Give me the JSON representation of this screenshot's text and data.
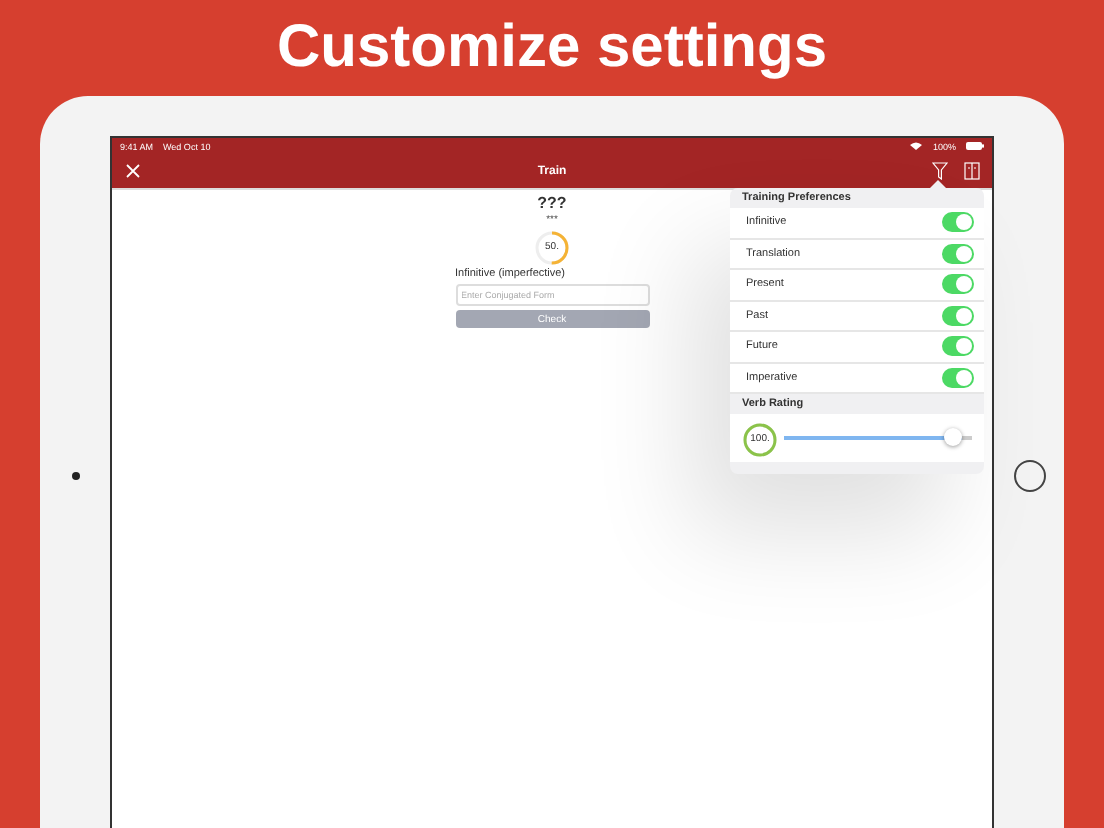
{
  "headline": "Customize settings",
  "status_bar": {
    "time": "9:41 AM",
    "date": "Wed Oct 10",
    "battery": "100%"
  },
  "nav": {
    "title": "Train"
  },
  "card": {
    "word": "???",
    "hint": "***",
    "progress": {
      "reading": "50."
    },
    "label": "Infinitive (imperfective)",
    "input": {
      "placeholder": "Enter Conjugated Form"
    },
    "button": {
      "label": "Check",
      "disabled": true
    }
  },
  "popover": {
    "sections": [
      {
        "title": "Training Preferences",
        "kind": "toggles",
        "items": [
          {
            "label": "Infinitive",
            "on": true
          },
          {
            "label": "Translation",
            "on": true
          },
          {
            "label": "Present",
            "on": true
          },
          {
            "label": "Past",
            "on": true
          },
          {
            "label": "Future",
            "on": true
          },
          {
            "label": "Imperative",
            "on": true
          }
        ]
      },
      {
        "title": "Verb Rating",
        "kind": "slider",
        "reading": "100.",
        "level": 0.95
      }
    ]
  }
}
